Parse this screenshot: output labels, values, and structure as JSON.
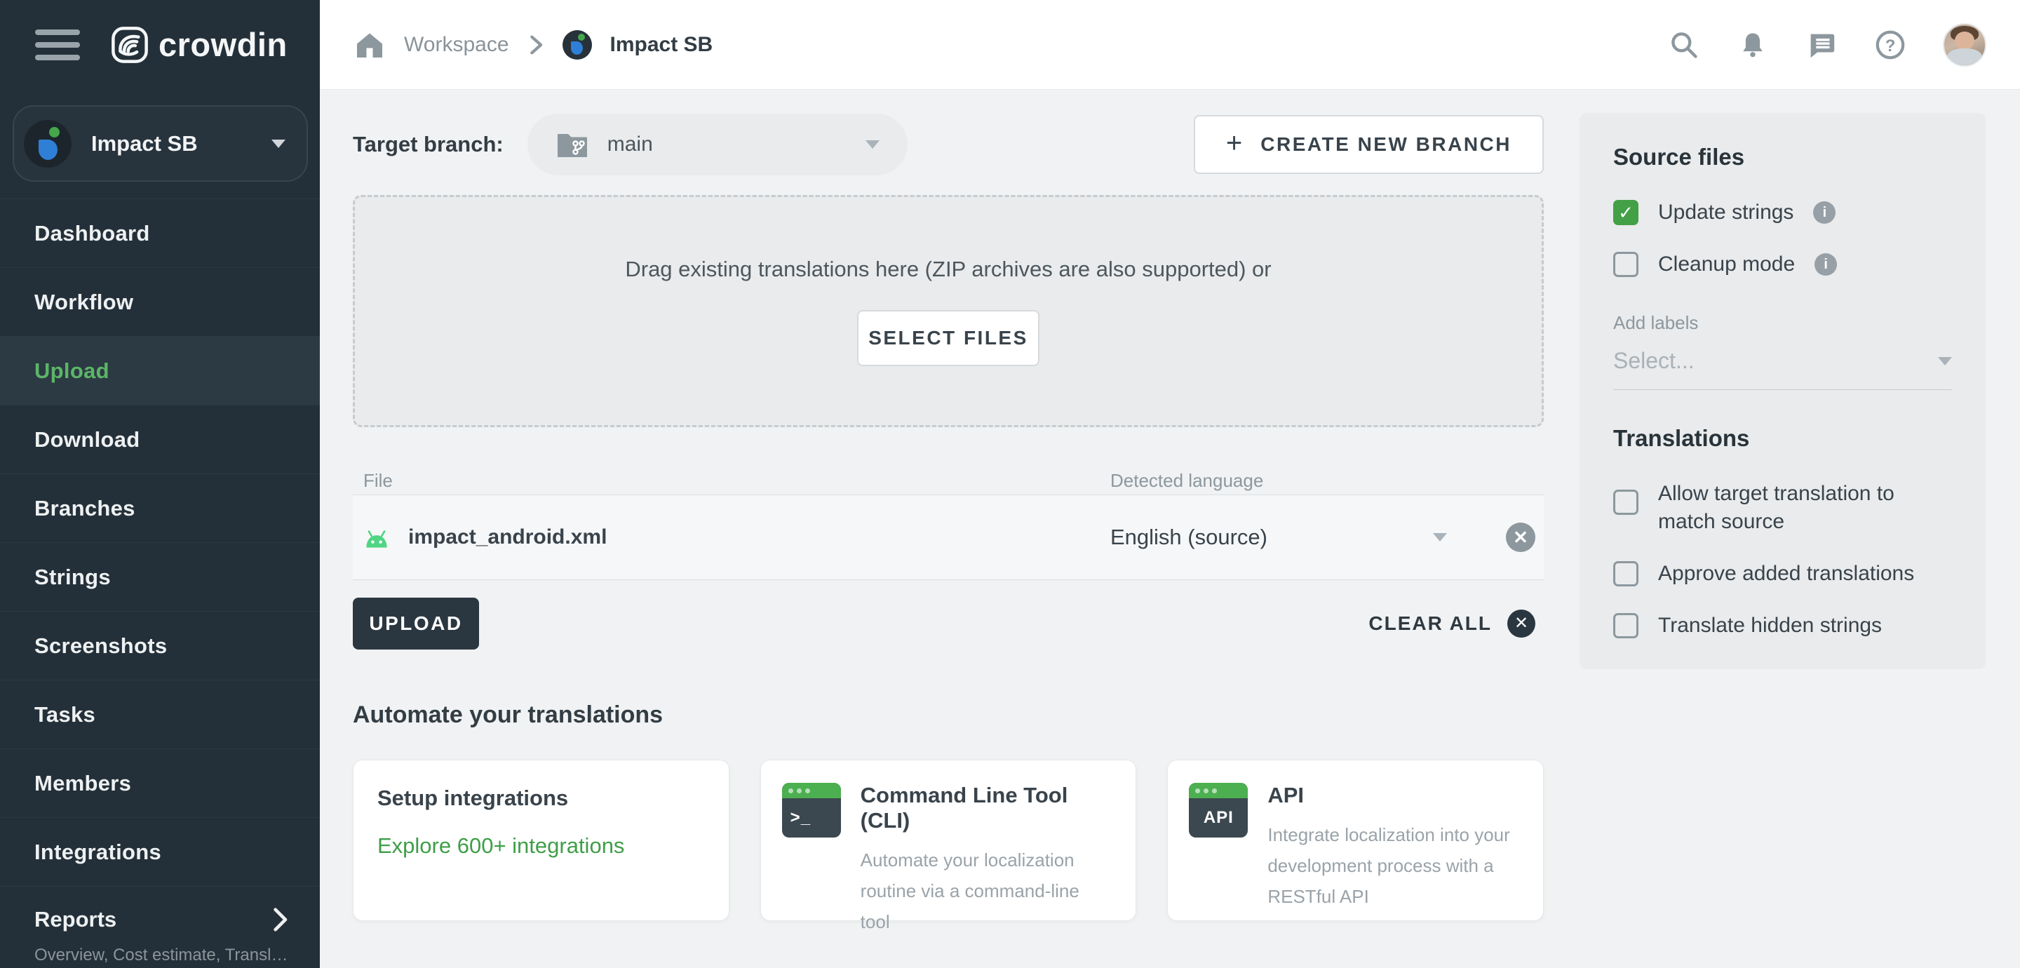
{
  "brand": {
    "wordmark": "crowdin"
  },
  "topbar": {
    "breadcrumb": {
      "workspace": "Workspace",
      "project": "Impact SB"
    }
  },
  "sidebar": {
    "project_name": "Impact SB",
    "items": [
      {
        "label": "Dashboard"
      },
      {
        "label": "Workflow"
      },
      {
        "label": "Upload",
        "active": true
      },
      {
        "label": "Download"
      },
      {
        "label": "Branches"
      },
      {
        "label": "Strings"
      },
      {
        "label": "Screenshots"
      },
      {
        "label": "Tasks"
      },
      {
        "label": "Members"
      },
      {
        "label": "Integrations"
      }
    ],
    "reports": {
      "label": "Reports",
      "sublabel": "Overview, Cost estimate, Transl…"
    }
  },
  "main": {
    "target_branch": {
      "label": "Target branch:",
      "value": "main"
    },
    "create_branch": {
      "plus": "+",
      "label": "CREATE NEW BRANCH"
    },
    "dropzone": {
      "text": "Drag existing translations here (ZIP archives are also supported) or",
      "button": "SELECT FILES"
    },
    "files": {
      "columns": {
        "file": "File",
        "language": "Detected language"
      },
      "rows": [
        {
          "name": "impact_android.xml",
          "language": "English (source)"
        }
      ]
    },
    "actions": {
      "upload": "UPLOAD",
      "clear_all": "CLEAR ALL"
    },
    "automate": {
      "title": "Automate your translations",
      "cards": [
        {
          "title": "Setup integrations",
          "link": "Explore 600+ integrations"
        },
        {
          "title": "Command Line Tool (CLI)",
          "description": "Automate your localization routine via a command-line tool",
          "icon_glyph": ">_"
        },
        {
          "title": "API",
          "description": "Integrate localization into your development process with a RESTful API",
          "icon_glyph": "API"
        }
      ]
    }
  },
  "panel": {
    "source_files": {
      "title": "Source files",
      "update_strings": "Update strings",
      "update_strings_checked": true,
      "check_glyph": "✓",
      "cleanup_mode": "Cleanup mode",
      "cleanup_mode_checked": false,
      "add_labels": "Add labels",
      "labels_placeholder": "Select...",
      "info_glyph": "i"
    },
    "translations": {
      "title": "Translations",
      "options": [
        "Allow target translation to match source",
        "Approve added translations",
        "Translate hidden strings"
      ]
    }
  },
  "icons": {
    "hamburger": "menu-icon",
    "home": "home-icon",
    "search": "search-icon",
    "notifications": "bell-icon",
    "messages": "chat-icon",
    "help": "question-icon",
    "branch_select": "branch-folder-icon",
    "file_type": "android-icon",
    "remove": "close-circle-icon",
    "remove_glyph": "✕"
  },
  "colors": {
    "sidebar_bg": "#243039",
    "accent_green": "#43a047",
    "upload_active_green": "#5cb567",
    "link_green": "#3f9e49",
    "android_green": "#4fd584",
    "dark_button_bg": "#2b3740",
    "panel_bg": "#e9ebec"
  }
}
